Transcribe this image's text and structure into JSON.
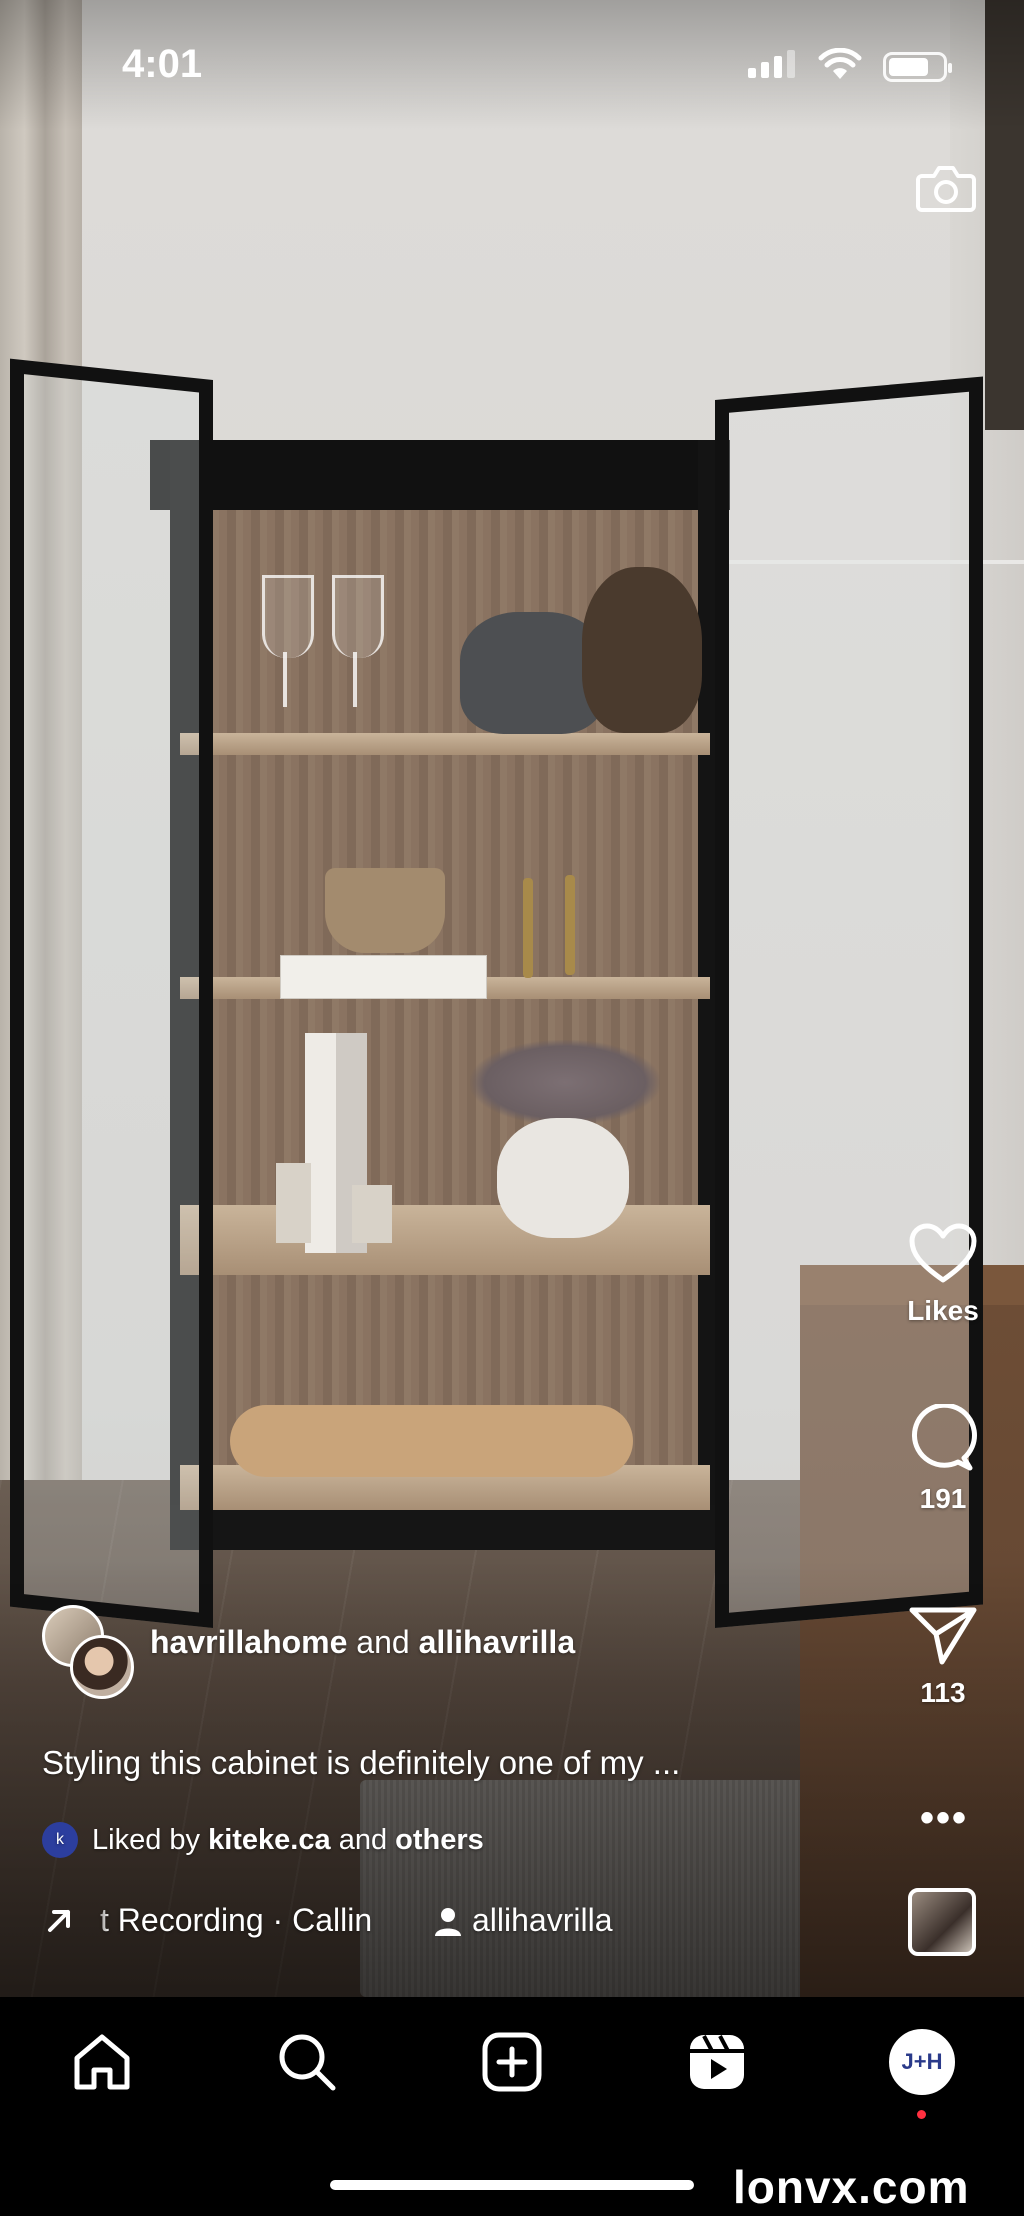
{
  "status_bar": {
    "time": "4:01",
    "battery_level": 0.75
  },
  "actions": {
    "likes_label": "Likes",
    "comments_count": "191",
    "shares_count": "113",
    "more_label": "•••"
  },
  "post": {
    "author_primary": "havrillahome",
    "author_connector": "and",
    "author_secondary": "allihavrilla",
    "caption": "Styling this cabinet is definitely one of my ...",
    "liked_prefix": "Liked by",
    "liked_user": "kiteke.ca",
    "liked_connector": "and",
    "liked_others": "others",
    "liked_avatar_text": "k",
    "audio_track": "t Recording · Callin",
    "tagged_user": "allihavrilla"
  },
  "nav": {
    "items": [
      "home-icon",
      "search-icon",
      "create-icon",
      "reels-icon",
      "profile-avatar"
    ],
    "profile_initials": "J+H"
  },
  "watermark": "lonvx.com",
  "colors": {
    "notification_dot": "#ff3040",
    "nav_bg": "#000000"
  }
}
